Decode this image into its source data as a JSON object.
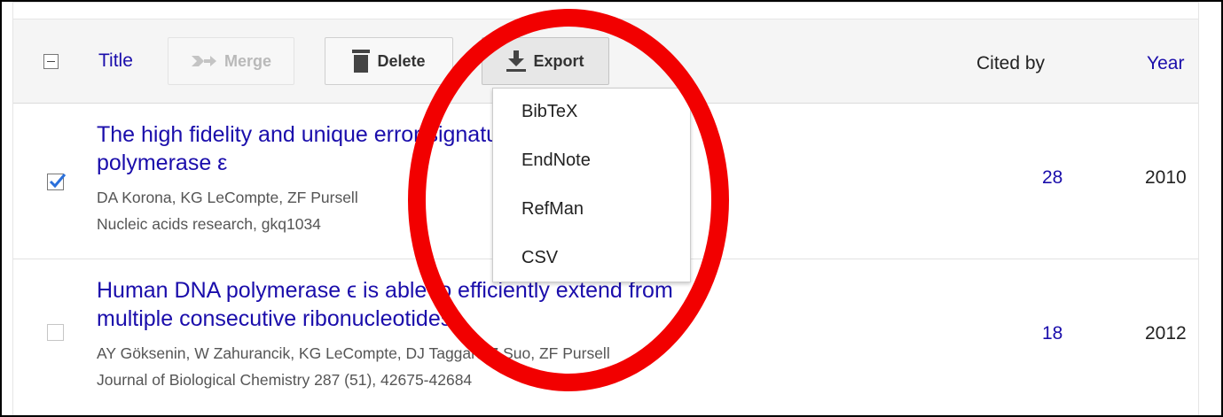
{
  "header": {
    "title_label": "Title",
    "merge_label": "Merge",
    "delete_label": "Delete",
    "export_label": "Export",
    "cited_by_label": "Cited by",
    "year_label": "Year"
  },
  "export_menu": {
    "items": [
      "BibTeX",
      "EndNote",
      "RefMan",
      "CSV"
    ]
  },
  "articles": [
    {
      "checked": true,
      "title_line1": "The high fidelity and unique error signature of human DNA",
      "title_line2": "polymerase ε",
      "authors": "DA Korona, KG LeCompte, ZF Pursell",
      "venue": "Nucleic acids research, gkq1034",
      "cited_by": "28",
      "year": "2010"
    },
    {
      "checked": false,
      "title_line1": "Human DNA polymerase ϵ is able to efficiently extend from",
      "title_line2": "multiple consecutive ribonucleotides",
      "authors": "AY Göksenin, W Zahurancik, KG LeCompte, DJ Taggart, Z Suo, ZF Pursell",
      "venue": "Journal of Biological Chemistry 287 (51), 42675-42684",
      "cited_by": "18",
      "year": "2012"
    }
  ],
  "annotation": {
    "color": "#f20000"
  },
  "colors": {
    "link": "#1a0dab",
    "header_bg": "#f5f5f5"
  }
}
